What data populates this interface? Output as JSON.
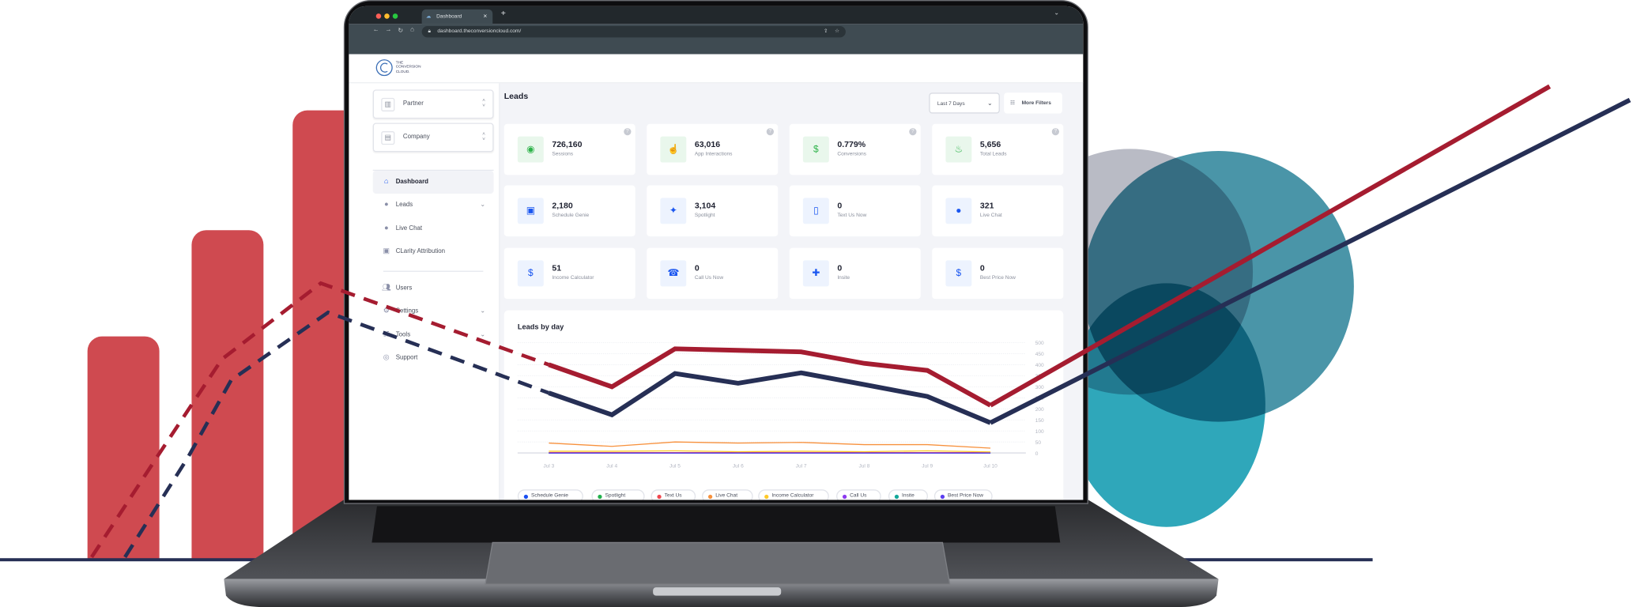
{
  "browser": {
    "tab_title": "Dashboard",
    "url": "dashboard.theconversioncloud.com/",
    "new_tab": "+"
  },
  "logo": {
    "line1": "THE",
    "line2": "CONVERSION",
    "line3": "CLOUD."
  },
  "sidebar": {
    "selects": [
      {
        "label": "Partner",
        "icon": "building-icon"
      },
      {
        "label": "Company",
        "icon": "office-icon"
      }
    ],
    "items": [
      {
        "label": "Dashboard",
        "icon": "home-icon",
        "active": true,
        "chevron": false
      },
      {
        "label": "Leads",
        "icon": "user-icon",
        "chevron": true
      },
      {
        "label": "Live Chat",
        "icon": "chat-icon",
        "chevron": false
      },
      {
        "label": "CLarity Attribution",
        "icon": "report-icon",
        "chevron": false
      },
      {
        "label": "Users",
        "icon": "users-icon",
        "chevron": false
      },
      {
        "label": "Settings",
        "icon": "gear-icon",
        "chevron": true
      },
      {
        "label": "Tools",
        "icon": "sliders-icon",
        "chevron": true
      },
      {
        "label": "Support",
        "icon": "lifebuoy-icon",
        "chevron": false
      }
    ]
  },
  "main": {
    "title": "Leads",
    "date_range": "Last 7 Days",
    "more_filters": "More Filters",
    "cards": [
      {
        "value": "726,160",
        "label": "Sessions",
        "icon": "eye-icon",
        "tone": "green",
        "help": true
      },
      {
        "value": "63,016",
        "label": "App Interactions",
        "icon": "tap-icon",
        "tone": "green",
        "help": true
      },
      {
        "value": "0.779%",
        "label": "Conversions",
        "icon": "dollar-icon",
        "tone": "green",
        "help": true
      },
      {
        "value": "5,656",
        "label": "Total Leads",
        "icon": "flame-icon",
        "tone": "green",
        "help": true
      },
      {
        "value": "2,180",
        "label": "Schedule Genie",
        "icon": "calendar-icon",
        "tone": "blue"
      },
      {
        "value": "3,104",
        "label": "Spotlight",
        "icon": "spotlight-icon",
        "tone": "blue"
      },
      {
        "value": "0",
        "label": "Text Us Now",
        "icon": "phone-message-icon",
        "tone": "blue"
      },
      {
        "value": "321",
        "label": "Live Chat",
        "icon": "chat-bubble-icon",
        "tone": "blue"
      },
      {
        "value": "51",
        "label": "Income Calculator",
        "icon": "calculator-icon",
        "tone": "blue"
      },
      {
        "value": "0",
        "label": "Call Us Now",
        "icon": "phone-ring-icon",
        "tone": "blue"
      },
      {
        "value": "0",
        "label": "Insite",
        "icon": "user-add-icon",
        "tone": "blue"
      },
      {
        "value": "0",
        "label": "Best Price Now",
        "icon": "dollar-circle-icon",
        "tone": "blue"
      }
    ]
  },
  "colors": {
    "accent_blue": "#1a56f0",
    "accent_green": "#2eb34a",
    "brand_red": "#a51c30",
    "brand_navy": "#262f55",
    "bar_red": "#cf4a50"
  },
  "chart_data": {
    "type": "line",
    "title": "Leads by day",
    "categories": [
      "Jul 3",
      "Jul 4",
      "Jul 5",
      "Jul 6",
      "Jul 7",
      "Jul 8",
      "Jul 9",
      "Jul 10"
    ],
    "yticks": [
      "500",
      "450",
      "400",
      "350",
      "300",
      "250",
      "200",
      "150",
      "100",
      "50",
      "0"
    ],
    "ylim": [
      0,
      500
    ],
    "grid": true,
    "legend_position": "bottom",
    "series": [
      {
        "color": "#a51c30",
        "values": [
          400,
          300,
          472,
          465,
          458,
          406,
          374,
          216
        ]
      },
      {
        "color": "#262f55",
        "values": [
          272,
          173,
          360,
          316,
          363,
          310,
          256,
          137
        ]
      },
      {
        "name": "Schedule Genie",
        "color": "#1a4ff0",
        "values": [
          0,
          0,
          0,
          0,
          0,
          0,
          0,
          0
        ]
      },
      {
        "name": "Spotlight",
        "color": "#22b14c",
        "values": [
          0,
          0,
          0,
          0,
          0,
          0,
          0,
          0
        ]
      },
      {
        "name": "Text Us",
        "color": "#f0474f",
        "values": [
          2,
          2,
          2,
          2,
          2,
          2,
          2,
          2
        ]
      },
      {
        "name": "Live Chat",
        "color": "#f7913d",
        "values": [
          45,
          30,
          50,
          45,
          48,
          38,
          38,
          22
        ]
      },
      {
        "name": "Income Calculator",
        "color": "#ffc928",
        "values": [
          8,
          8,
          10,
          6,
          8,
          6,
          10,
          5
        ]
      },
      {
        "name": "Call Us",
        "color": "#8c3bef",
        "values": [
          0,
          0,
          0,
          0,
          0,
          0,
          0,
          0
        ]
      },
      {
        "name": "Insite",
        "color": "#14a89a",
        "values": [
          0,
          0,
          0,
          0,
          0,
          0,
          0,
          0
        ]
      },
      {
        "name": "Best Price Now",
        "color": "#5b3ef0",
        "values": [
          0,
          0,
          0,
          0,
          0,
          0,
          0,
          0
        ]
      }
    ]
  }
}
